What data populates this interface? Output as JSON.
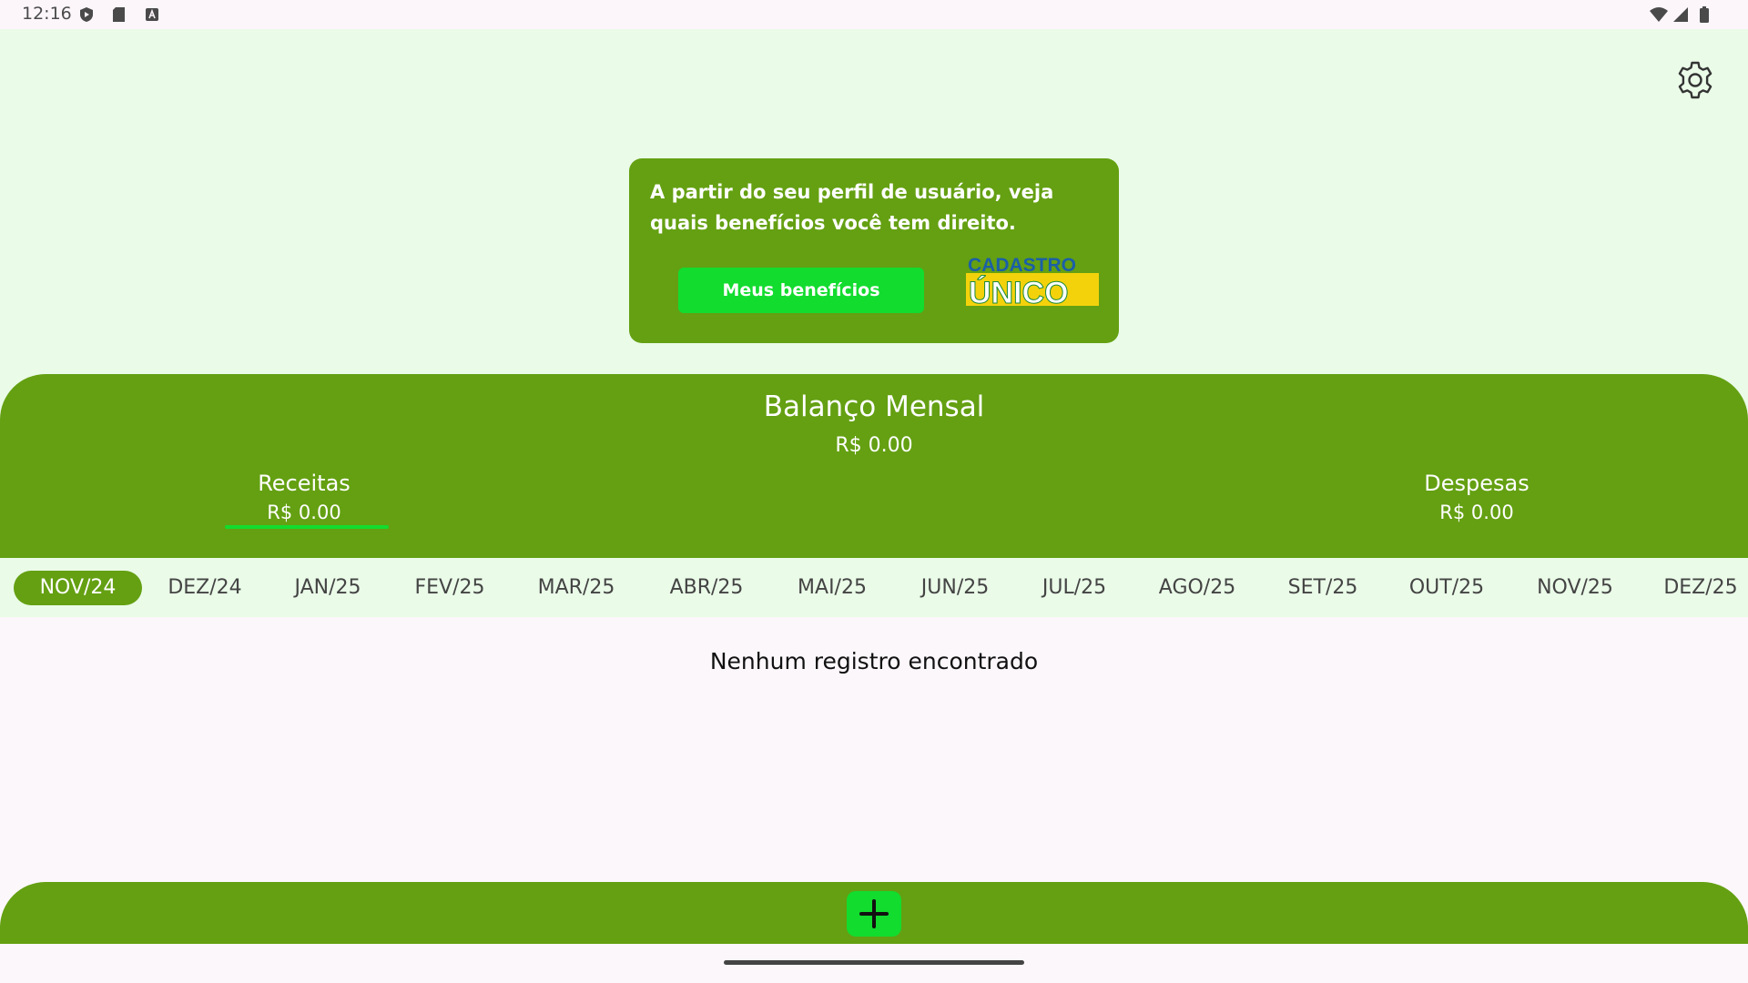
{
  "status_bar": {
    "time": "12:16",
    "icons_left": [
      "shield-icon",
      "sd-card-icon",
      "a-box-icon"
    ],
    "icons_right": [
      "wifi-icon",
      "signal-icon",
      "battery-icon"
    ]
  },
  "header": {
    "settings_icon": "gear-icon"
  },
  "benefit_card": {
    "text": "A partir do seu perfil de usuário, veja quais benefícios você tem direito.",
    "button_label": "Meus benefícios",
    "logo_line1": "CADASTRO",
    "logo_line2": "ÚNICO"
  },
  "balance": {
    "title": "Balanço Mensal",
    "total": "R$ 0.00",
    "income_label": "Receitas",
    "income_value": "R$ 0.00",
    "expense_label": "Despesas",
    "expense_value": "R$ 0.00"
  },
  "months": {
    "items": [
      "NOV/24",
      "DEZ/24",
      "JAN/25",
      "FEV/25",
      "MAR/25",
      "ABR/25",
      "MAI/25",
      "JUN/25",
      "JUL/25",
      "AGO/25",
      "SET/25",
      "OUT/25",
      "NOV/25",
      "DEZ/25"
    ],
    "selected": "NOV/24"
  },
  "records": {
    "empty_message": "Nenhum registro encontrado"
  },
  "bottom_bar": {
    "add_icon": "plus-icon"
  },
  "colors": {
    "primary_green": "#64a012",
    "accent_green": "#12dc2e",
    "light_green_bg": "#eafbe8",
    "page_bg": "#fcf7fb"
  }
}
